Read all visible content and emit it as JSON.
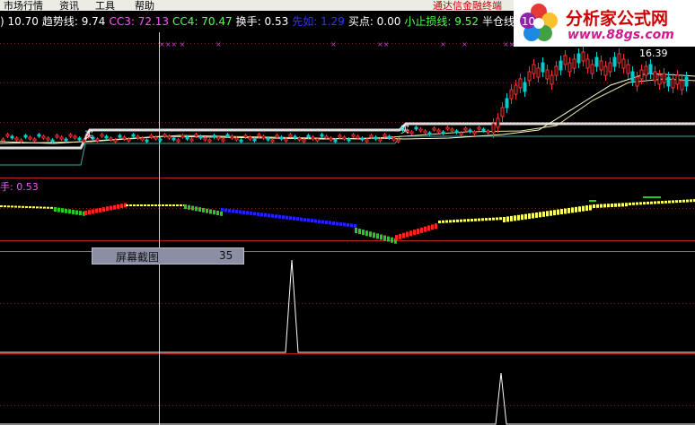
{
  "menu": [
    "市场行情",
    "资讯",
    "工具",
    "帮助"
  ],
  "terminal_title": "通达信金融终端",
  "logo": {
    "text": "分析家公式网",
    "url": "www.88gs.com"
  },
  "indicators": [
    {
      "label": ")",
      "value": "10.70",
      "color": "#ffffff"
    },
    {
      "label": "趋势线:",
      "value": "9.74",
      "color": "#ffffff"
    },
    {
      "label": "CC3:",
      "value": "72.13",
      "color": "#ff55ff"
    },
    {
      "label": "CC4:",
      "value": "70.47",
      "color": "#55ff55"
    },
    {
      "label": "换手:",
      "value": "0.53",
      "color": "#ffffff"
    },
    {
      "label": "先如:",
      "value": "1.29",
      "color": "#3333ff"
    },
    {
      "label": "买点:",
      "value": "0.00",
      "color": "#ffffff"
    },
    {
      "label": "小止损线:",
      "value": "9.52",
      "color": "#55ff55"
    },
    {
      "label": "半仓线:",
      "value": "10",
      "color": "#ffffff"
    }
  ],
  "price_label": "16.39",
  "buy_marks": [
    "买",
    "买"
  ],
  "oscillator_label": "手: 0.53",
  "popup": {
    "label": "屏幕截图",
    "value": "35"
  },
  "chart_data": {
    "type": "line",
    "price_high_label": 16.39,
    "oscillator_value": 0.53,
    "colors": {
      "up": "#ff3333",
      "down": "#00cccc",
      "panel_line": "#b22222",
      "ma": "#ffffcc"
    }
  }
}
